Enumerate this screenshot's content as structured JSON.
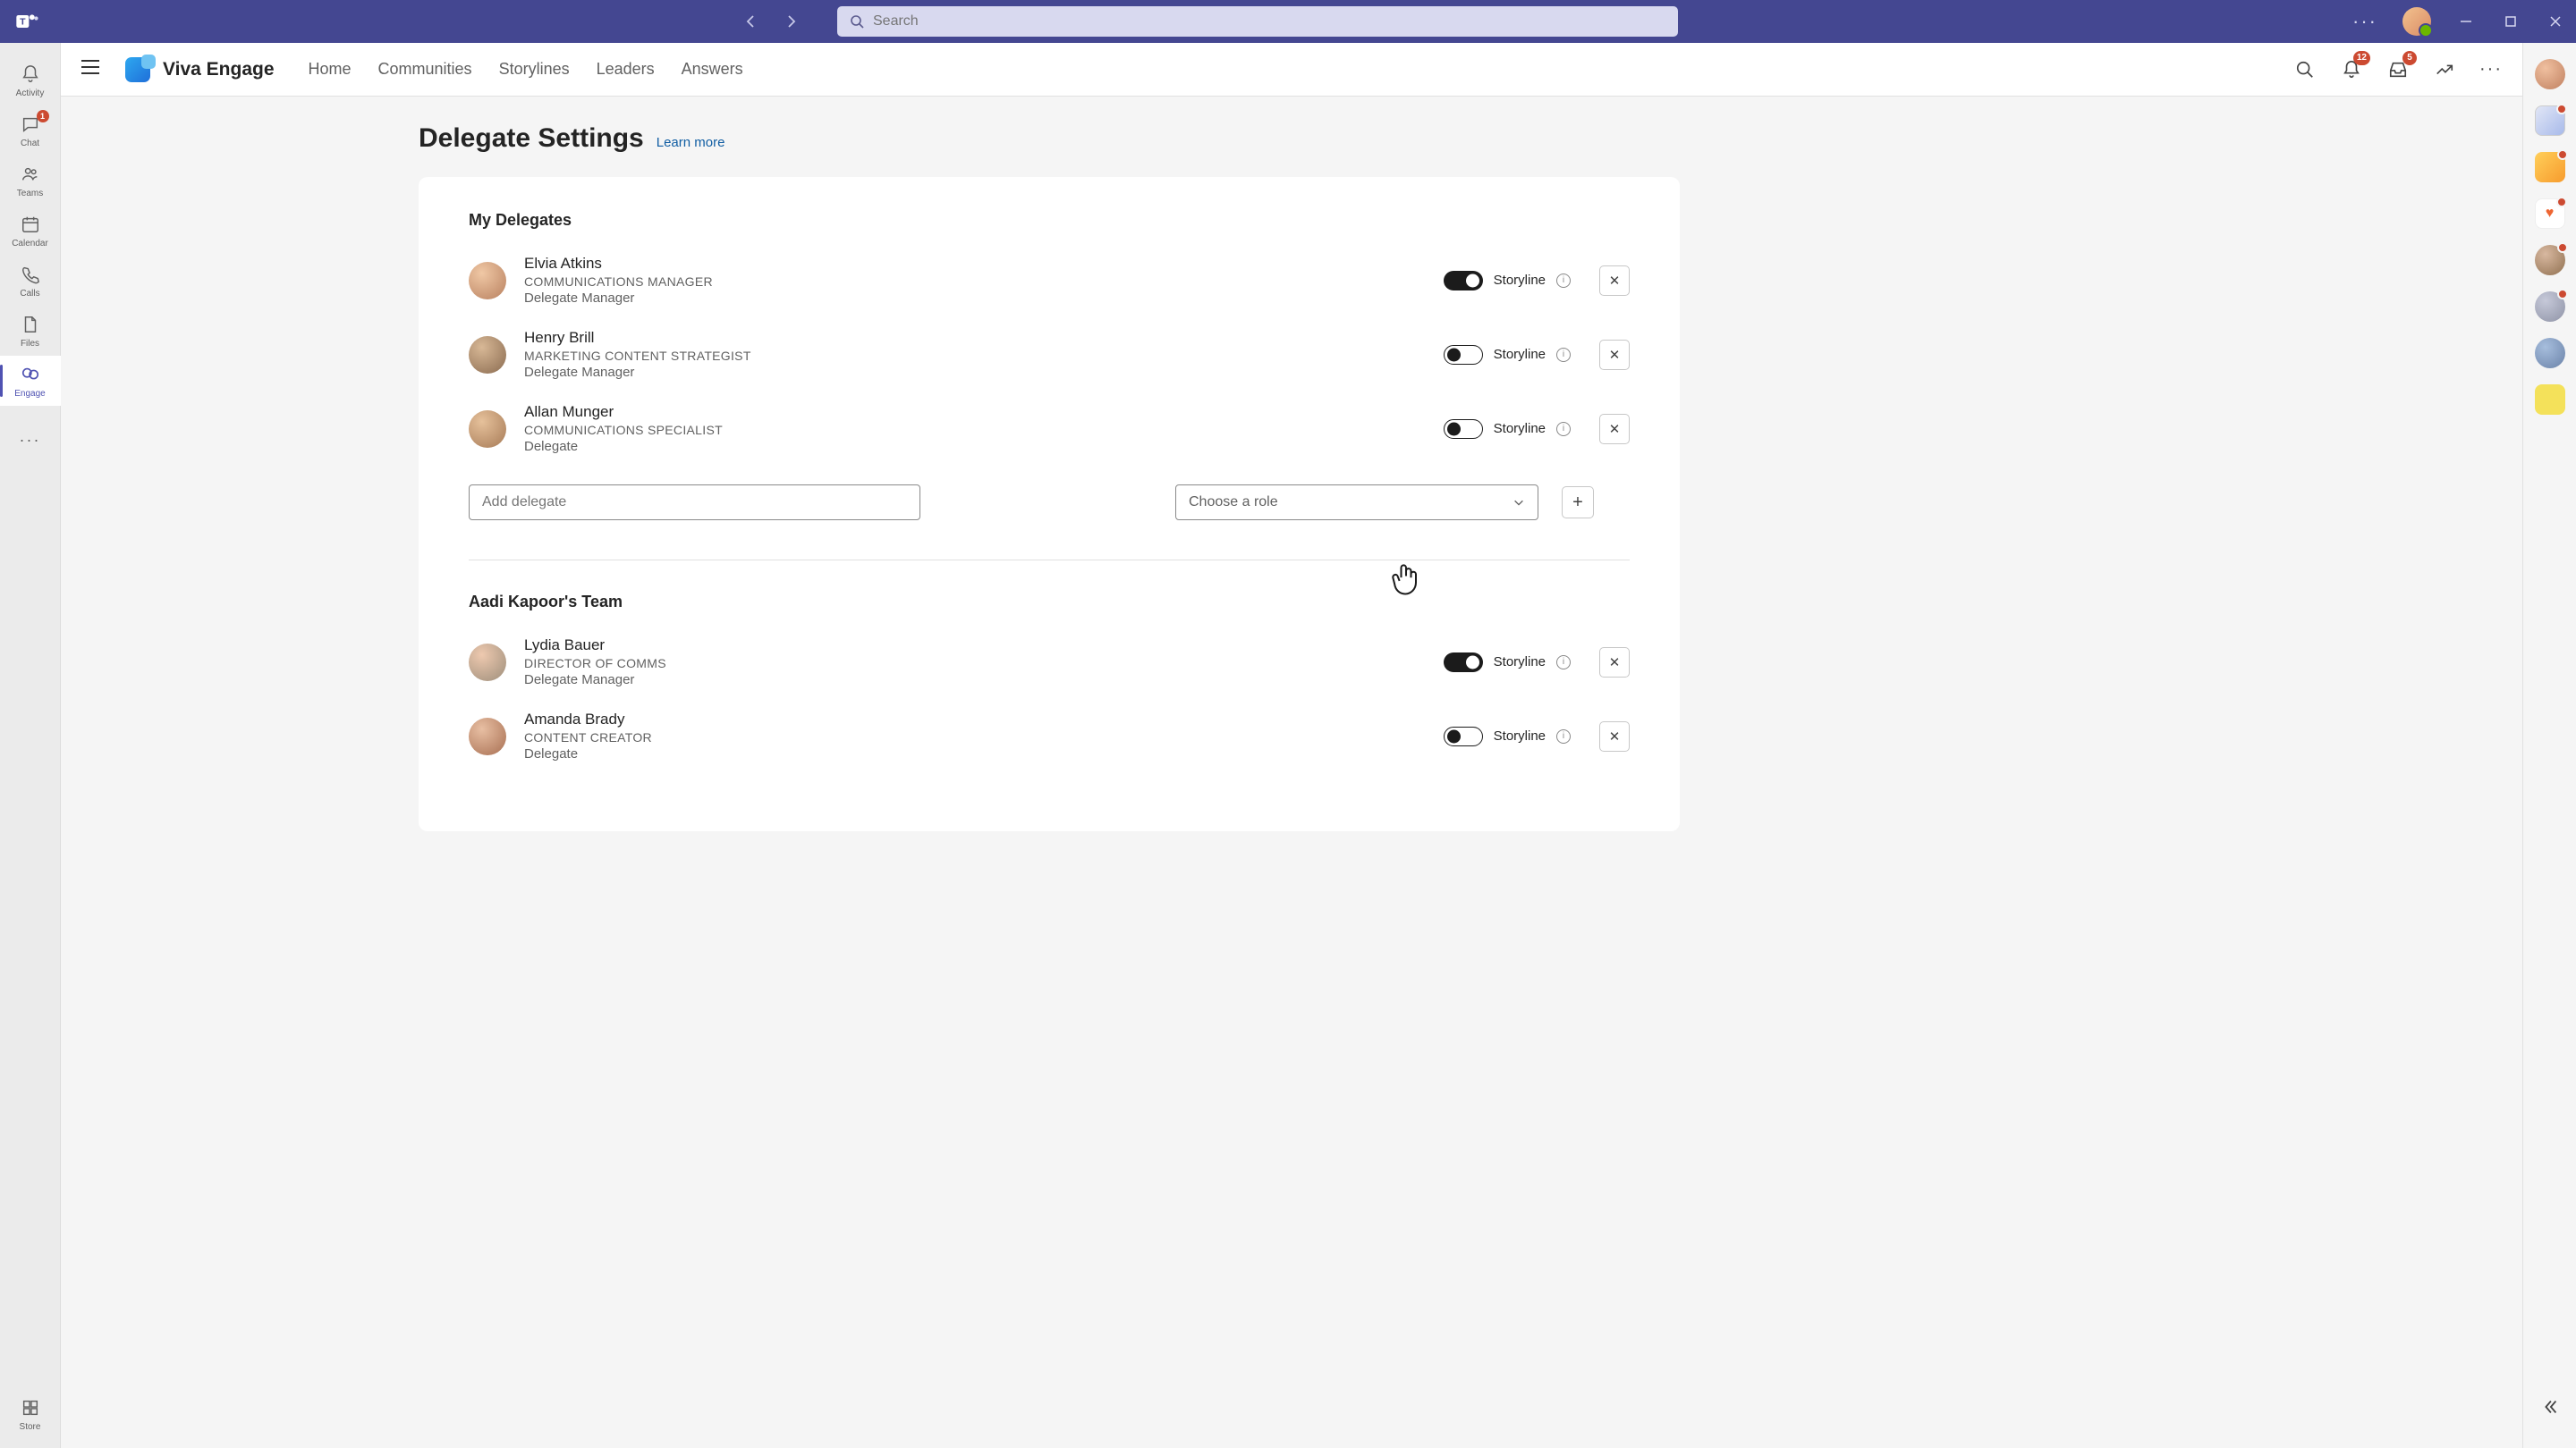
{
  "titlebar": {
    "search_placeholder": "Search"
  },
  "leftrail": {
    "activity": "Activity",
    "chat": "Chat",
    "chat_badge": "1",
    "teams": "Teams",
    "calendar": "Calendar",
    "calls": "Calls",
    "files": "Files",
    "engage": "Engage",
    "store": "Store"
  },
  "appbar": {
    "brand": "Viva Engage",
    "nav": {
      "home": "Home",
      "communities": "Communities",
      "storylines": "Storylines",
      "leaders": "Leaders",
      "answers": "Answers"
    },
    "notif_badge": "12",
    "inbox_badge": "5"
  },
  "page": {
    "title": "Delegate Settings",
    "learn_more": "Learn more",
    "section1_title": "My Delegates",
    "section2_title": "Aadi Kapoor's Team",
    "storyline_label": "Storyline",
    "add_placeholder": "Add delegate",
    "role_placeholder": "Choose a role",
    "delegates": [
      {
        "name": "Elvia Atkins",
        "title": "COMMUNICATIONS MANAGER",
        "role": "Delegate Manager",
        "toggle": true
      },
      {
        "name": "Henry Brill",
        "title": "MARKETING CONTENT STRATEGIST",
        "role": "Delegate Manager",
        "toggle": false
      },
      {
        "name": "Allan Munger",
        "title": "COMMUNICATIONS SPECIALIST",
        "role": "Delegate",
        "toggle": false
      }
    ],
    "team": [
      {
        "name": "Lydia Bauer",
        "title": "DIRECTOR OF COMMS",
        "role": "Delegate Manager",
        "toggle": true
      },
      {
        "name": "Amanda Brady",
        "title": "CONTENT CREATOR",
        "role": "Delegate",
        "toggle": false
      }
    ]
  }
}
